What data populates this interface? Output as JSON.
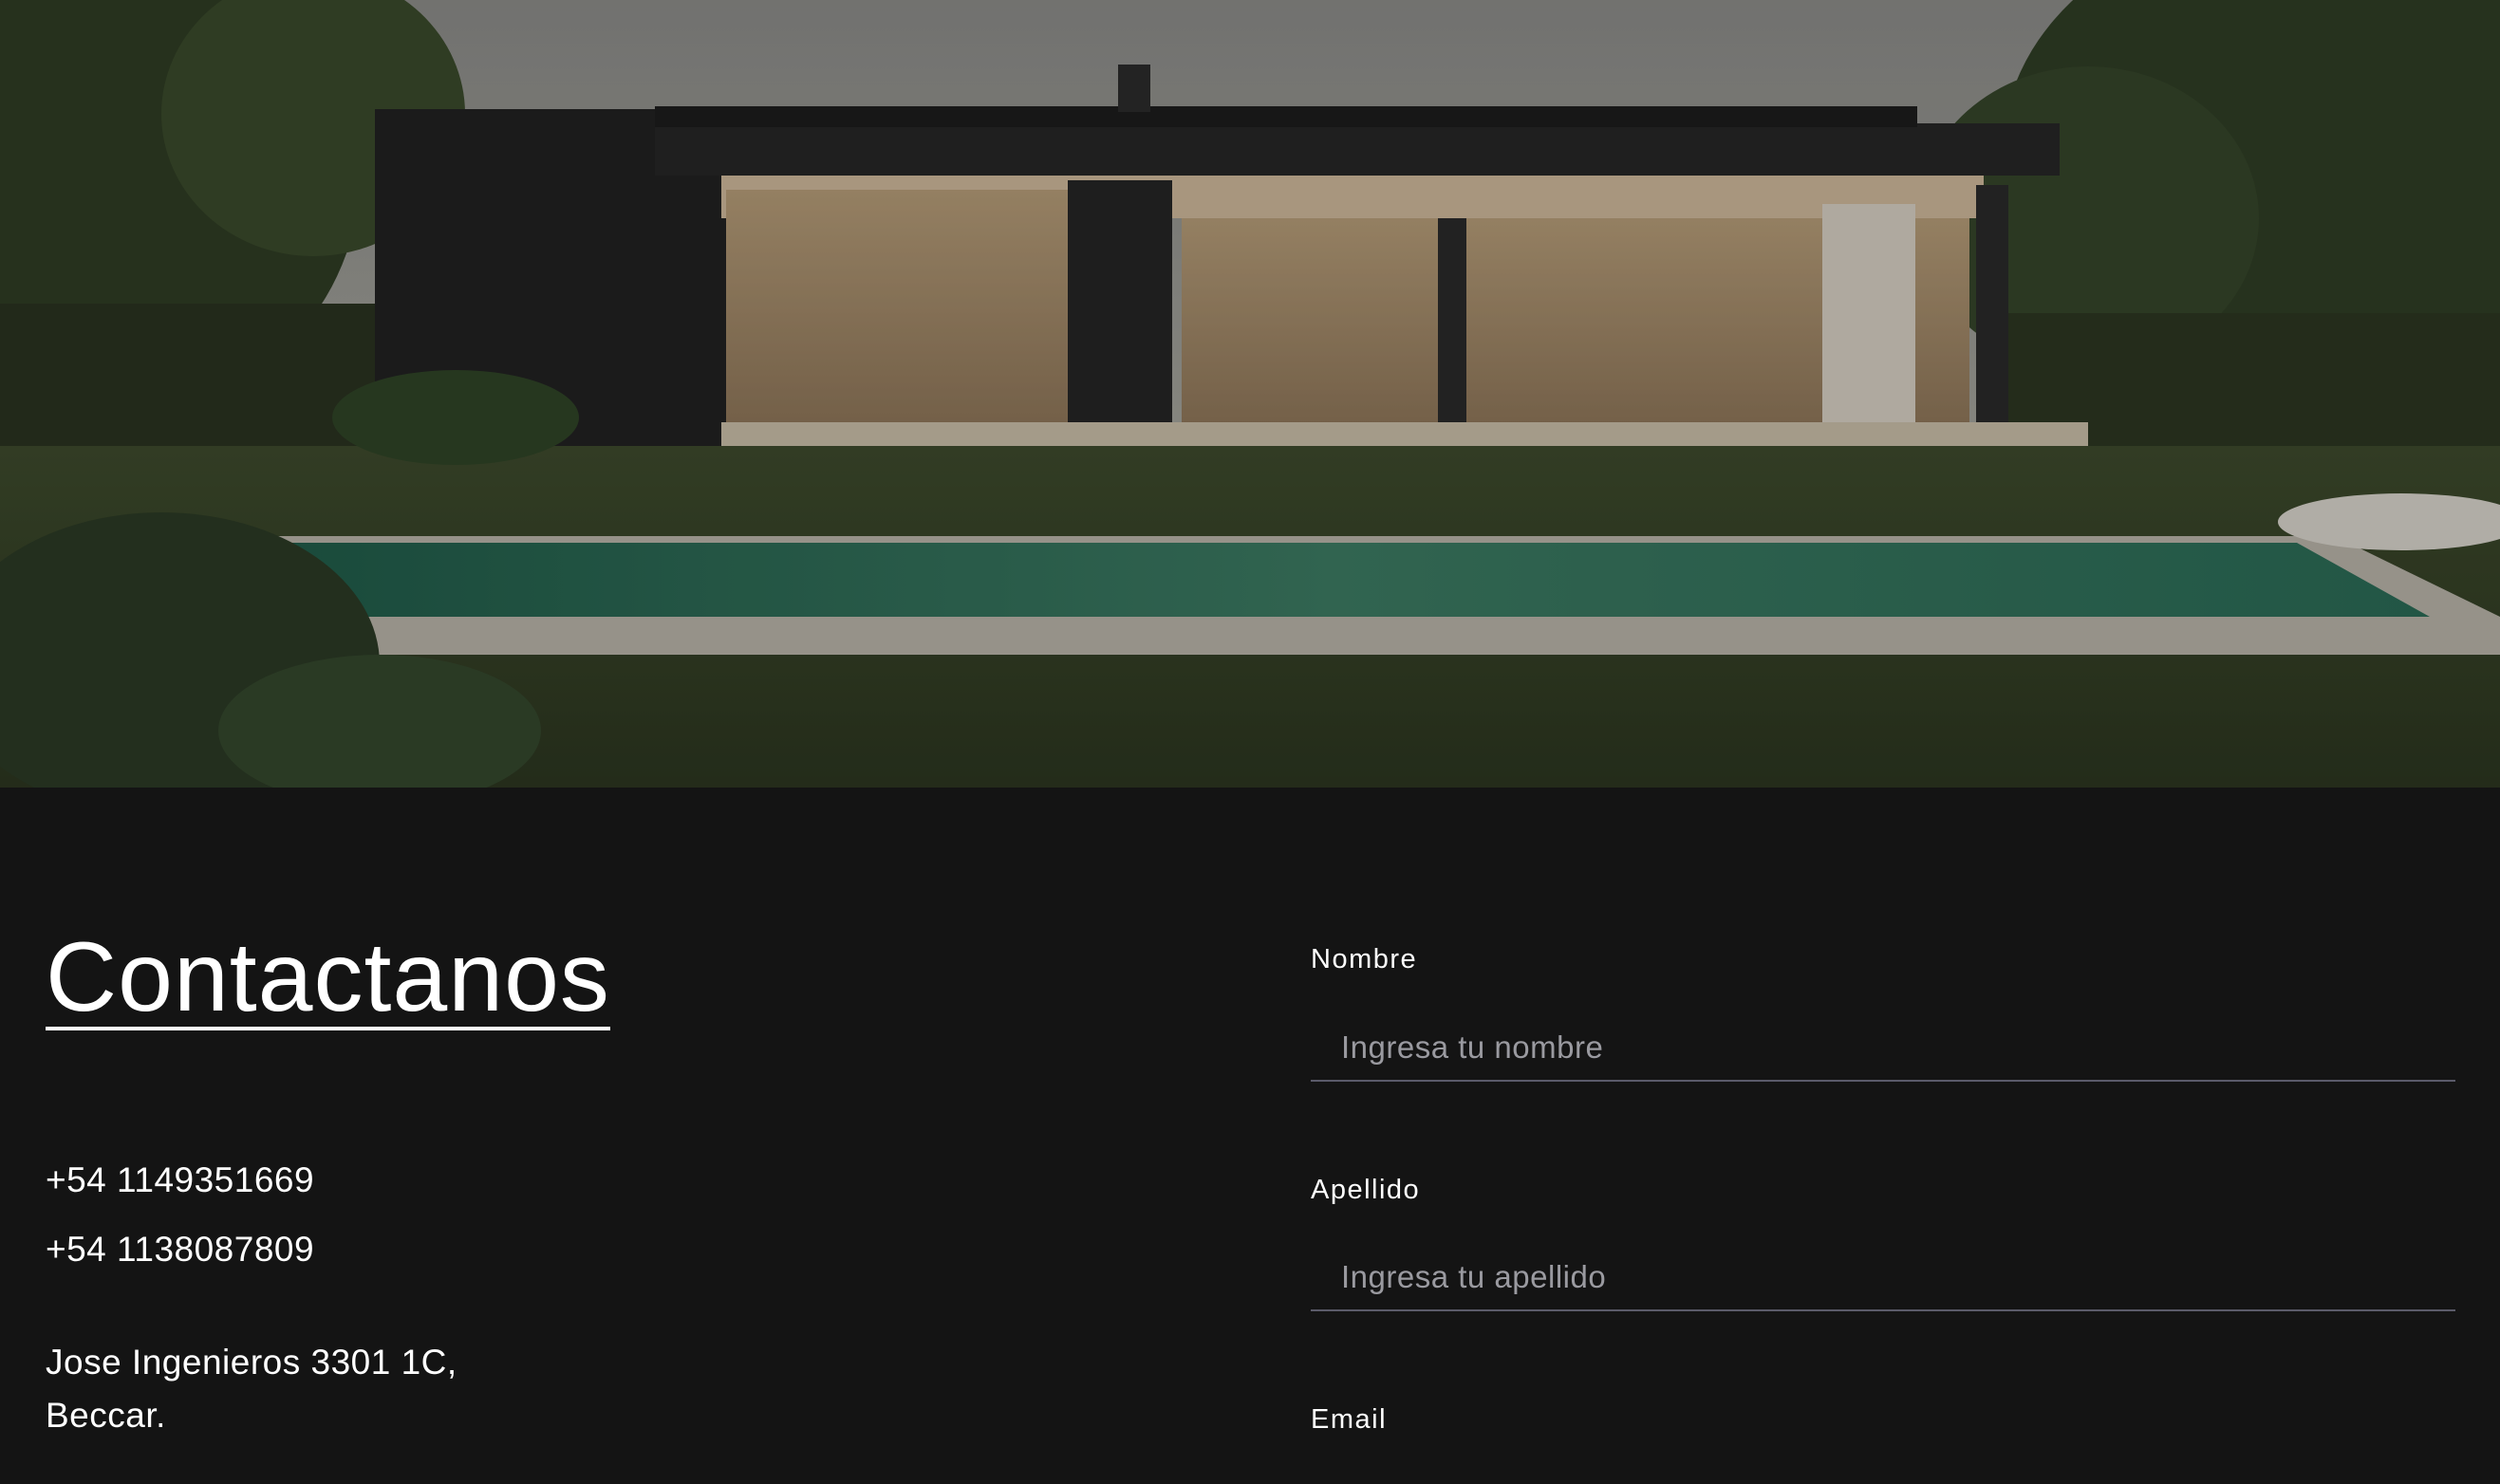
{
  "hero": {
    "image": "modern-house-with-pool-photo"
  },
  "contact": {
    "title": "Contactanos",
    "phones": [
      "+54 1149351669",
      "+54 1138087809"
    ],
    "address_line1": "Jose Ingenieros 3301 1C,",
    "address_line2": "Beccar."
  },
  "form": {
    "nombre": {
      "label": "Nombre",
      "placeholder": "Ingresa tu nombre"
    },
    "apellido": {
      "label": "Apellido",
      "placeholder": "Ingresa tu apellido"
    },
    "email": {
      "label": "Email"
    }
  },
  "colors": {
    "background": "#141414",
    "text": "#ffffff",
    "input_border": "#5b5b6a",
    "placeholder": "#9a9aa0"
  }
}
